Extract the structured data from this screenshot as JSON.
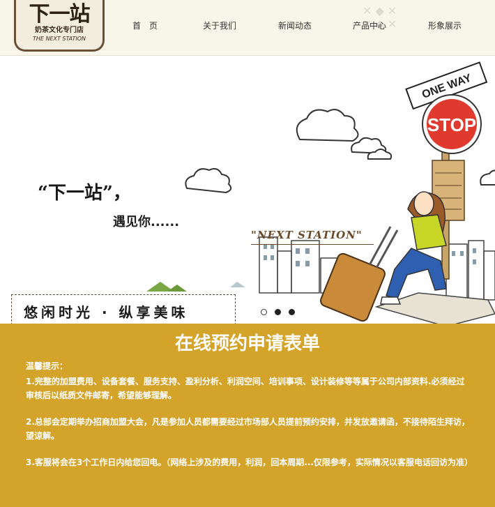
{
  "header": {
    "logo": {
      "main": "下一站",
      "sub": "奶茶文化专门店",
      "en": "THE NEXT STATION"
    },
    "nav": [
      {
        "label": "首　页"
      },
      {
        "label": "关于我们"
      },
      {
        "label": "新闻动态"
      },
      {
        "label": "产品中心"
      },
      {
        "label": "形象展示"
      }
    ]
  },
  "banner": {
    "slogan_main": "“下一站”，",
    "slogan_meet": "遇见你......",
    "slogan_en": "\"NEXT     STATION\"",
    "slogan_box": "悠闲时光 · 纵享美味",
    "sign_stop": "STOP",
    "sign_oneway": "ONE WAY",
    "carousel": {
      "dots": 3,
      "active": 2
    }
  },
  "form": {
    "title": "在线预约申请表单",
    "notice_head": "温馨提示：",
    "notices": [
      "1.完整的加盟费用、设备套餐、服务支持、盈利分析、利润空间、培训事项、设计装修等等属于公司内部资料.必须经过审核后以纸质文件邮寄，希望能够理解。",
      "2.总部会定期举办招商加盟大会，凡是参加人员都需要经过市场部人员提前预约安排，并发放邀请函，不接待陌生拜访，望谅解。",
      "3.客服将会在3个工作日内给您回电。（网络上涉及的费用，利润，回本周期...仅限参考，实际情况以客服电话回访为准）"
    ]
  },
  "colors": {
    "header_bg": "#f8f6e9",
    "form_bg": "#d4a32a",
    "stop_red": "#e03a2f"
  }
}
